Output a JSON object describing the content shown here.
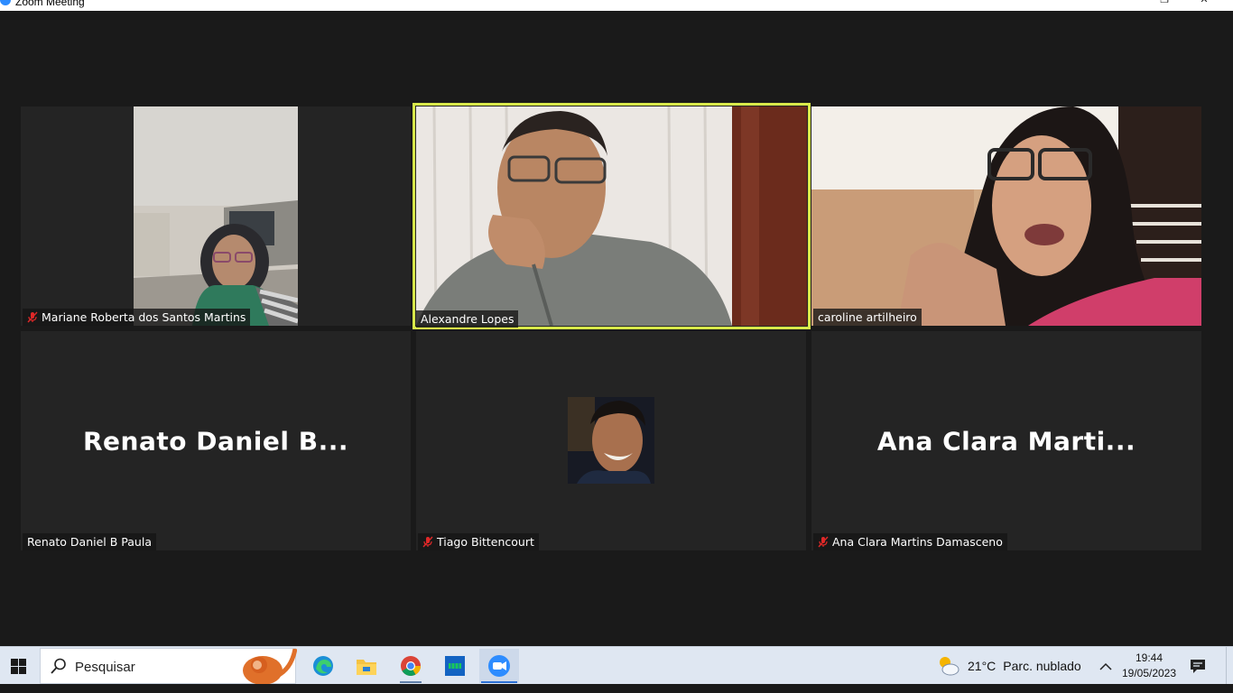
{
  "window": {
    "title": "Zoom Meeting"
  },
  "participants": [
    {
      "name": "Mariane Roberta dos Santos Martins",
      "muted": true,
      "video": true,
      "active": false
    },
    {
      "name": "Alexandre Lopes",
      "muted": false,
      "video": true,
      "active": true
    },
    {
      "name": "caroline artilheiro",
      "muted": false,
      "video": true,
      "active": false
    },
    {
      "name": "Renato Daniel B Paula",
      "muted": false,
      "video": false,
      "display_name": "Renato Daniel B..."
    },
    {
      "name": "Tiago Bittencourt",
      "muted": true,
      "video": false,
      "avatar": true
    },
    {
      "name": "Ana Clara Martins Damasceno",
      "muted": true,
      "video": false,
      "display_name": "Ana Clara Marti..."
    }
  ],
  "taskbar": {
    "search_placeholder": "Pesquisar",
    "apps": [
      "edge-icon",
      "file-explorer-icon",
      "chrome-icon",
      "app-green-icon",
      "zoom-icon"
    ],
    "weather_temp": "21°C",
    "weather_desc": "Parc. nublado",
    "time": "19:44",
    "date": "19/05/2023"
  },
  "colors": {
    "active_speaker": "#d8e84a",
    "mute": "#e02828",
    "zoom_blue": "#2d8cff"
  }
}
